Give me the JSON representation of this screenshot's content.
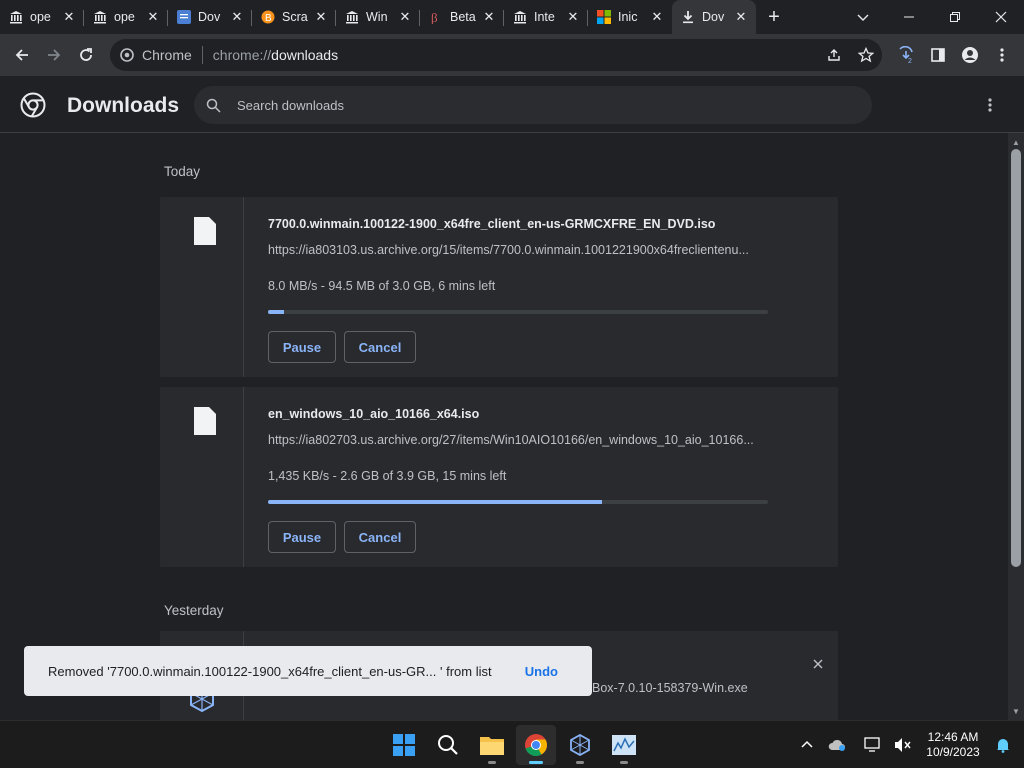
{
  "tabs": [
    {
      "title": "ope",
      "icon": "archive-icon"
    },
    {
      "title": "ope",
      "icon": "archive-icon"
    },
    {
      "title": "Dov",
      "icon": "doc-icon"
    },
    {
      "title": "Scra",
      "icon": "bitcoin-icon"
    },
    {
      "title": "Win",
      "icon": "archive-icon"
    },
    {
      "title": "Beta",
      "icon": "beta-icon"
    },
    {
      "title": "Inte",
      "icon": "archive-icon"
    },
    {
      "title": "Inic",
      "icon": "windows-icon"
    },
    {
      "title": "Dov",
      "icon": "download-icon",
      "active": true
    }
  ],
  "omnibox": {
    "chip_label": "Chrome",
    "url_scheme": "chrome://",
    "url_host": "downloads"
  },
  "header": {
    "title": "Downloads",
    "search_placeholder": "Search downloads"
  },
  "sections": {
    "today": "Today",
    "yesterday": "Yesterday"
  },
  "downloads": [
    {
      "filename": "7700.0.winmain.100122-1900_x64fre_client_en-us-GRMCXFRE_EN_DVD.iso",
      "url": "https://ia803103.us.archive.org/15/items/7700.0.winmain.1001221900x64freclientenu...",
      "status": "8.0 MB/s - 94.5 MB of 3.0 GB, 6 mins left",
      "progress": 0.031,
      "pause_label": "Pause",
      "cancel_label": "Cancel"
    },
    {
      "filename": "en_windows_10_aio_10166_x64.iso",
      "url": "https://ia802703.us.archive.org/27/items/Win10AIO10166/en_windows_10_aio_10166...",
      "status": "1,435 KB/s - 2.6 GB of 3.9 GB, 15 mins left",
      "progress": 0.667,
      "pause_label": "Pause",
      "cancel_label": "Cancel"
    }
  ],
  "partial_item": {
    "filename_tail": "Box-7.0.10-158379-Win.exe"
  },
  "toast": {
    "message": "Removed '7700.0.winmain.100122-1900_x64fre_client_en-us-GR... ' from list",
    "undo_label": "Undo"
  },
  "clock": {
    "time": "12:46 AM",
    "date": "10/9/2023"
  },
  "colors": {
    "accent": "#8ab4f8",
    "background": "#202124",
    "card": "#292a2d"
  }
}
